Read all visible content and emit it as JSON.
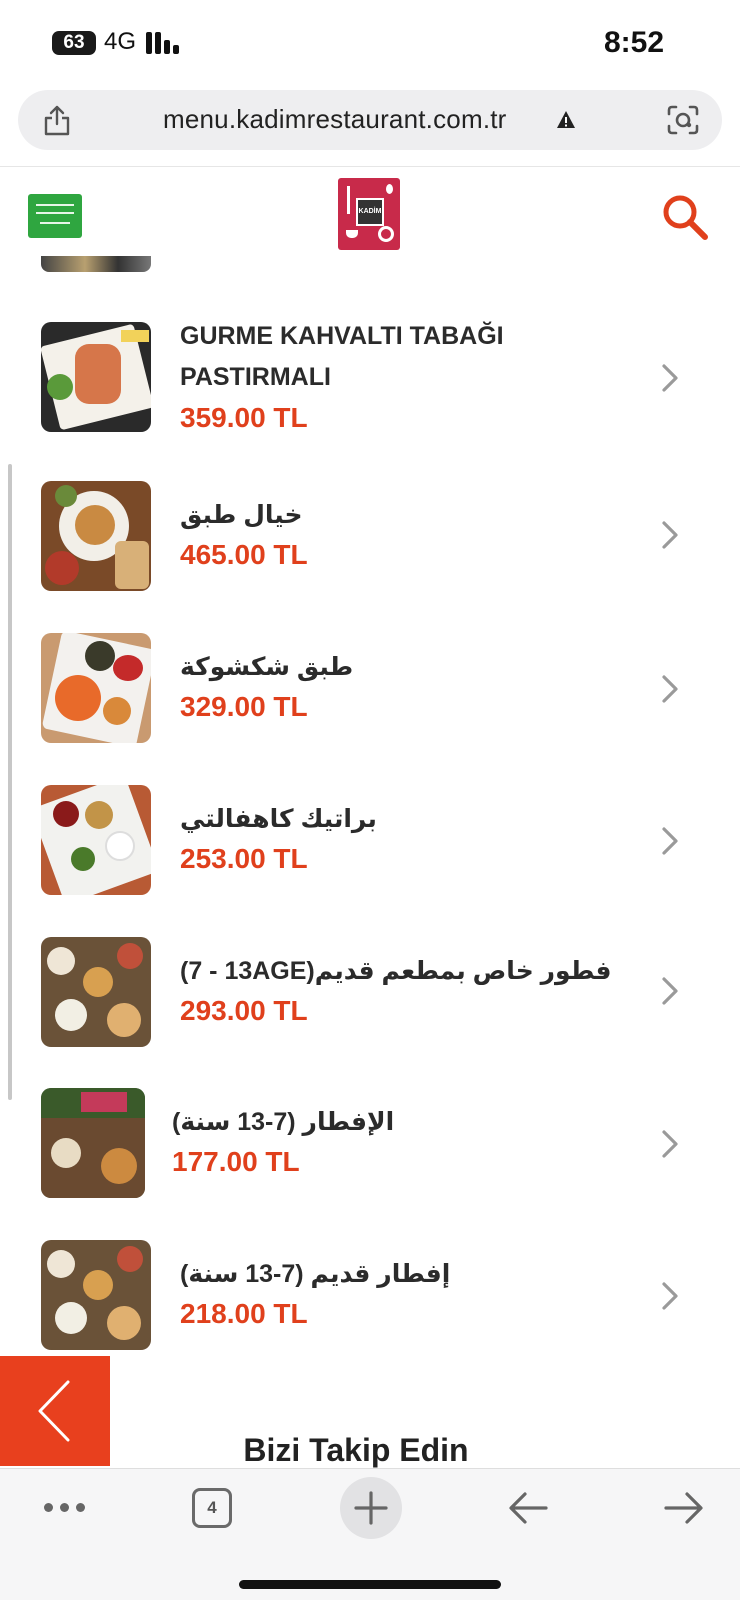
{
  "status_bar": {
    "battery": "63",
    "network": "4G",
    "time": "8:52"
  },
  "browser": {
    "url": "menu.kadimrestaurant.com.tr",
    "tab_count": "4",
    "icons": [
      "share-icon",
      "warning-icon",
      "visual-lookup-icon",
      "more-icon",
      "tabs-icon",
      "new-tab-icon",
      "back-arrow-icon",
      "forward-arrow-icon"
    ]
  },
  "header": {
    "language_flag": "saudi-arabia-flag-icon",
    "logo_text": "KADİM",
    "search_icon": "search-icon",
    "accent_color": "#e0401c"
  },
  "menu_items": [
    {
      "name_line1": "GURME KAHVALTI TABAĞI",
      "name_line2": "PASTIRMALI",
      "price": "359.00 TL"
    },
    {
      "name": "خيال طبق",
      "price": "465.00 TL"
    },
    {
      "name": "طبق شكشوكة",
      "price": "329.00 TL"
    },
    {
      "name": "براتيك كاهفالتي",
      "price": "253.00 TL"
    },
    {
      "name": "(7 - 13AGE)فطور خاص بمطعم قديم",
      "price": "293.00 TL"
    },
    {
      "name": "الإفطار (7-13 سنة)",
      "price": "177.00 TL"
    },
    {
      "name": "إفطار قديم (7-13 سنة)",
      "price": "218.00 TL"
    }
  ],
  "footer": {
    "follow_heading": "Bizi Takip Edin"
  }
}
